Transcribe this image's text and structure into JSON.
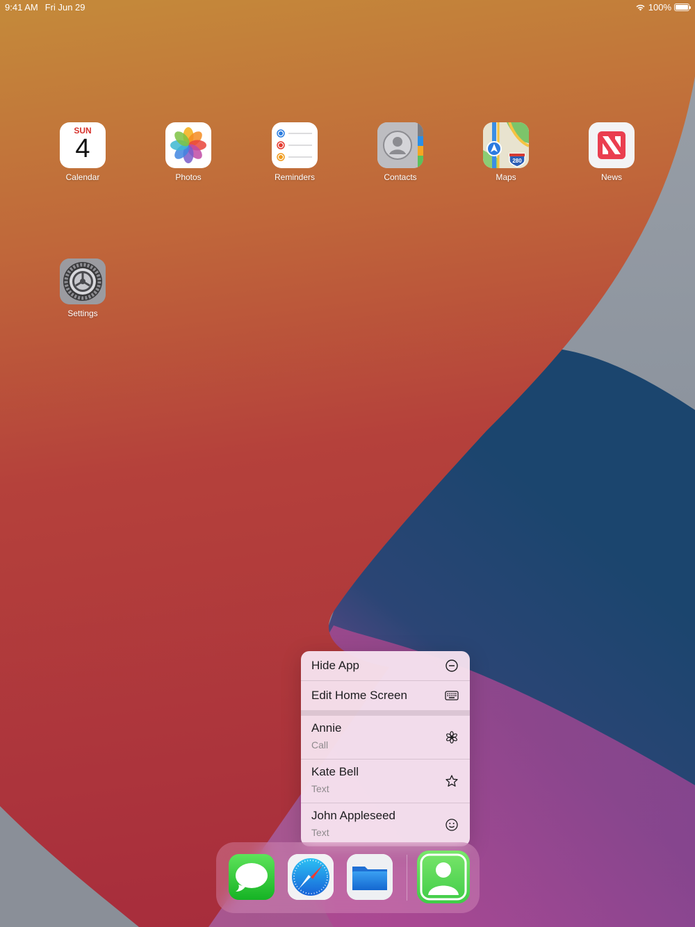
{
  "status_bar": {
    "time": "9:41 AM",
    "date": "Fri Jun 29",
    "battery_text": "100%",
    "battery_level": 1.0
  },
  "apps": [
    {
      "label": "Calendar",
      "weekday": "SUN",
      "day": "4"
    },
    {
      "label": "Photos"
    },
    {
      "label": "Reminders"
    },
    {
      "label": "Contacts"
    },
    {
      "label": "Maps",
      "shield": "280"
    },
    {
      "label": "News"
    },
    {
      "label": "Settings"
    }
  ],
  "context_menu": {
    "actions": [
      {
        "title": "Hide App",
        "icon": "minus-circle-icon"
      },
      {
        "title": "Edit Home Screen",
        "icon": "keyboard-icon"
      }
    ],
    "contacts": [
      {
        "name": "Annie",
        "action": "Call",
        "icon": "asterisk-flower-icon"
      },
      {
        "name": "Kate Bell",
        "action": "Text",
        "icon": "star-icon"
      },
      {
        "name": "John Appleseed",
        "action": "Text",
        "icon": "smiley-icon"
      }
    ]
  },
  "dock": {
    "apps": [
      {
        "icon": "messages-icon"
      },
      {
        "icon": "safari-icon"
      },
      {
        "icon": "files-icon"
      },
      {
        "icon": "contacts-icon"
      }
    ]
  },
  "colors": {
    "wallpaper_orange": "#c4873a",
    "wallpaper_red": "#b0353a",
    "wallpaper_blue": "#1f4670",
    "wallpaper_purple": "#9a4a95",
    "calendar_red": "#d6322c",
    "news_red": "#ea3e4f"
  }
}
